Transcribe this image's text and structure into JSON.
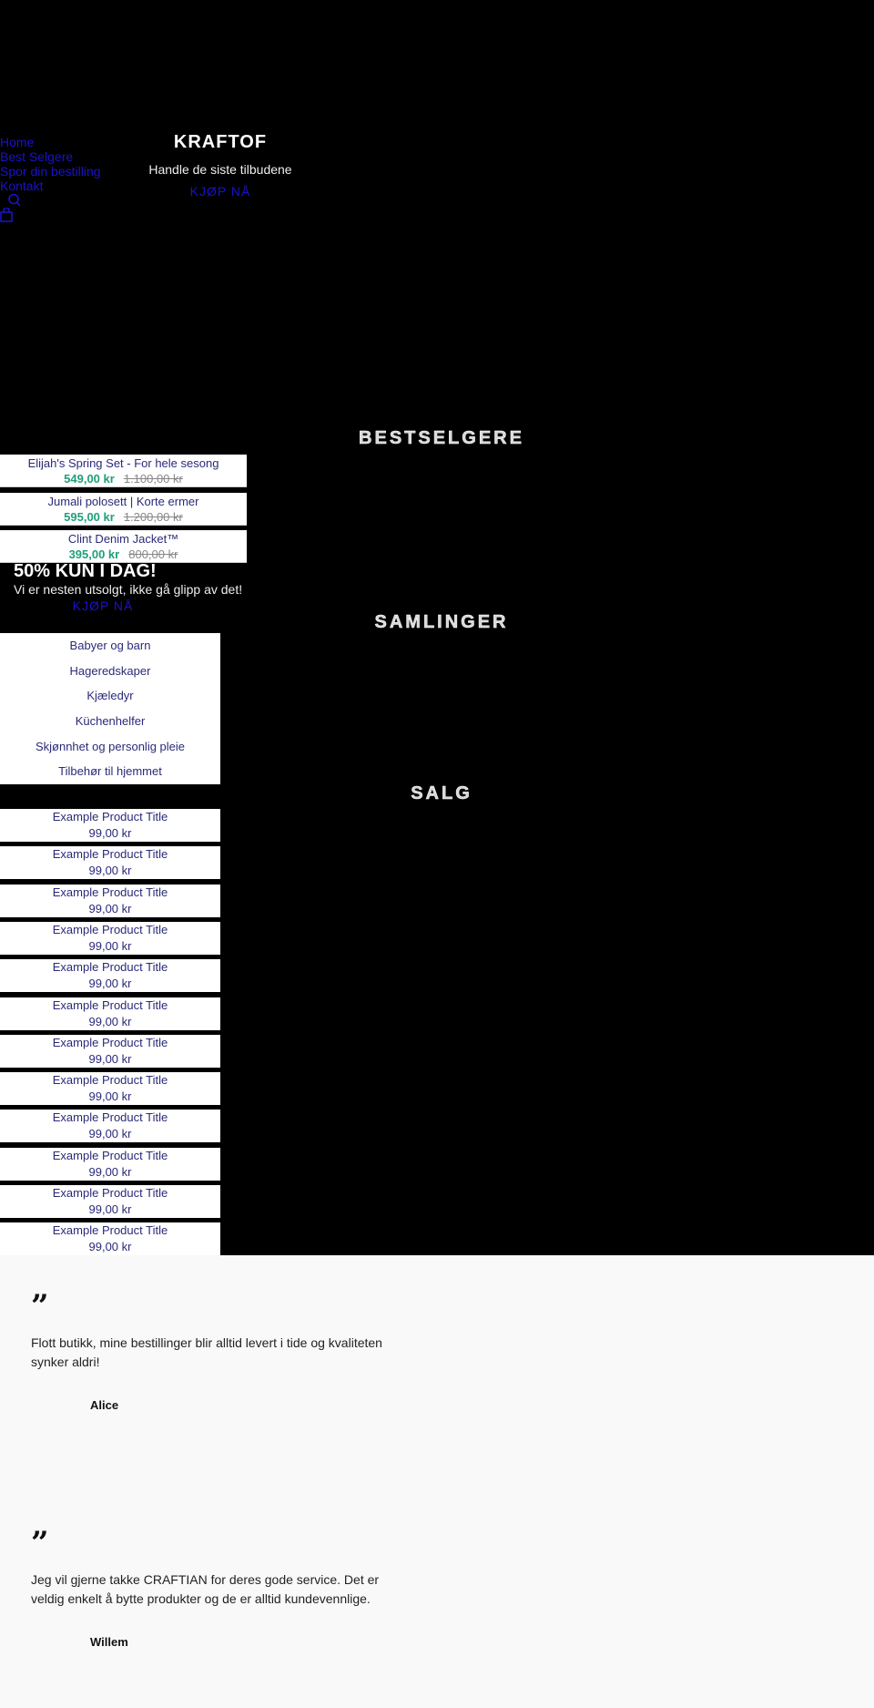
{
  "nav": {
    "items": [
      "Home",
      "Best Selgere",
      "Spor din bestilling",
      "Kontakt"
    ],
    "search_icon": "search-icon",
    "cart_icon": "shopping-bag-icon"
  },
  "hero": {
    "title": "KRAFTOF",
    "subtitle": "Handle de siste tilbudene",
    "cta": "KJØP NÅ"
  },
  "bestsellers": {
    "heading": "BESTSELGERE",
    "products": [
      {
        "title": "Elijah's Spring Set - For hele sesong",
        "price": "549,00 kr",
        "original": "1.100,00 kr"
      },
      {
        "title": "Jumali polosett | Korte ermer",
        "price": "595,00 kr",
        "original": "1.200,00 kr"
      },
      {
        "title": "Clint Denim Jacket™",
        "price": "395,00 kr",
        "original": "800,00 kr"
      }
    ]
  },
  "promo": {
    "heading": "50% KUN I DAG!",
    "text": "Vi er nesten utsolgt, ikke gå glipp av det!",
    "cta": "KJØP NÅ"
  },
  "collections": {
    "heading": "SAMLINGER",
    "items": [
      "Babyer og barn",
      "Hageredskaper",
      "Kjæledyr",
      "Küchenhelfer",
      "Skjønnhet og personlig pleie",
      "Tilbehør til hjemmet"
    ]
  },
  "sale": {
    "heading": "SALG",
    "products": [
      {
        "title": "Example Product Title",
        "price": "99,00 kr"
      },
      {
        "title": "Example Product Title",
        "price": "99,00 kr"
      },
      {
        "title": "Example Product Title",
        "price": "99,00 kr"
      },
      {
        "title": "Example Product Title",
        "price": "99,00 kr"
      },
      {
        "title": "Example Product Title",
        "price": "99,00 kr"
      },
      {
        "title": "Example Product Title",
        "price": "99,00 kr"
      },
      {
        "title": "Example Product Title",
        "price": "99,00 kr"
      },
      {
        "title": "Example Product Title",
        "price": "99,00 kr"
      },
      {
        "title": "Example Product Title",
        "price": "99,00 kr"
      },
      {
        "title": "Example Product Title",
        "price": "99,00 kr"
      },
      {
        "title": "Example Product Title",
        "price": "99,00 kr"
      },
      {
        "title": "Example Product Title",
        "price": "99,00 kr"
      }
    ]
  },
  "testimonials": [
    {
      "quote_mark": "”",
      "text": "Flott butikk, mine bestillinger blir alltid levert i tide og kvaliteten synker aldri!",
      "author": "Alice"
    },
    {
      "quote_mark": "”",
      "text": "Jeg vil gjerne takke CRAFTIAN for deres gode service. Det er veldig enkelt å bytte produkter og de er alltid kundevennlige.",
      "author": "Willem"
    }
  ],
  "colors": {
    "link": "#1a12c9",
    "sale_price": "#1f9f7a",
    "product_title": "#2a2a7a",
    "background": "#000000",
    "testimonial_bg": "#f9f9f9"
  }
}
